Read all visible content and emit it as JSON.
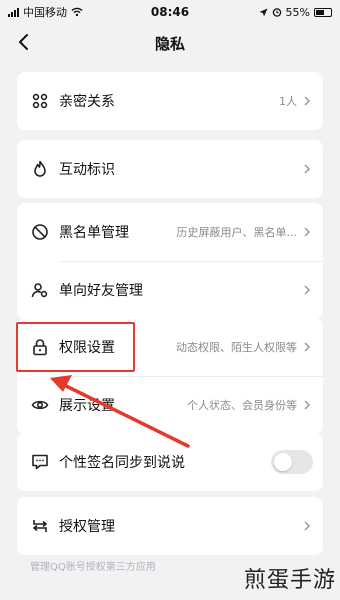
{
  "status_bar": {
    "carrier": "中国移动",
    "time": "08:46",
    "battery": "55%"
  },
  "nav": {
    "title": "隐私"
  },
  "settings": [
    {
      "label": "亲密关系",
      "value": "1人"
    },
    {
      "label": "互动标识",
      "value": ""
    },
    {
      "label": "黑名单管理",
      "value": "历史屏蔽用户、黑名单..."
    },
    {
      "label": "单向好友管理",
      "value": ""
    },
    {
      "label": "权限设置",
      "value": "动态权限、陌生人权限等"
    },
    {
      "label": "展示设置",
      "value": "个人状态、会员身份等"
    },
    {
      "label": "个性签名同步到说说",
      "value": ""
    },
    {
      "label": "授权管理",
      "value": ""
    }
  ],
  "footnote": "管理QQ账号授权第三方应用",
  "watermark": "煎蛋手游",
  "colors": {
    "accent": "#e23b2e",
    "background": "#f2f2f4",
    "card": "#ffffff"
  }
}
